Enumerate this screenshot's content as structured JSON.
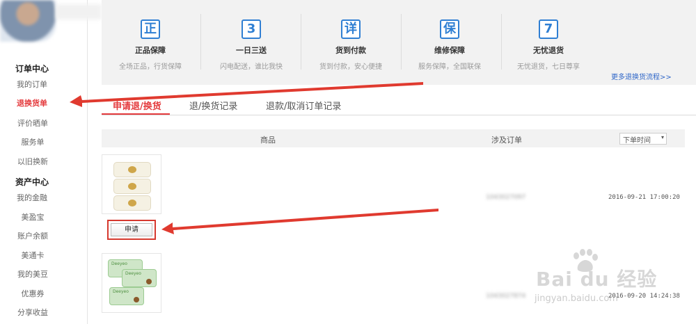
{
  "sidebar": {
    "section_orders": "订单中心",
    "orders": [
      {
        "label": "我的订单"
      },
      {
        "label": "退换货单",
        "active": true
      },
      {
        "label": "评价晒单"
      },
      {
        "label": "服务单"
      },
      {
        "label": "以旧换新"
      }
    ],
    "section_assets": "资产中心",
    "assets": [
      {
        "label": "我的金融"
      },
      {
        "label": "美盈宝"
      },
      {
        "label": "账户余额"
      },
      {
        "label": "美通卡"
      },
      {
        "label": "我的美豆"
      },
      {
        "label": "优惠券"
      },
      {
        "label": "分享收益"
      }
    ]
  },
  "services": [
    {
      "icon": "正",
      "icon_name": "authentic-icon",
      "title": "正品保障",
      "desc": "全场正品，行货保障"
    },
    {
      "icon": "3",
      "icon_name": "three-deliveries-icon",
      "title": "一日三送",
      "desc": "闪电配送，谁比我快"
    },
    {
      "icon": "详",
      "icon_name": "cod-icon",
      "title": "货到付款",
      "desc": "货到付款，安心便捷"
    },
    {
      "icon": "保",
      "icon_name": "warranty-icon",
      "title": "维修保障",
      "desc": "服务保障，全国联保"
    },
    {
      "icon": "7",
      "icon_name": "seven-day-return-icon",
      "title": "无忧退货",
      "desc": "无忧退货，七日尊享"
    }
  ],
  "more_link": "更多退换货流程>>",
  "tabs": [
    {
      "label": "申请退/换货",
      "active": true
    },
    {
      "label": "退/换货记录"
    },
    {
      "label": "退款/取消订单记录"
    }
  ],
  "table": {
    "col_goods": "商品",
    "col_order": "涉及订单",
    "sort_label": "下单时间",
    "sort_caret": "▾"
  },
  "rows": [
    {
      "order_id": "1043027097",
      "time": "2016-09-21 17:00:20",
      "apply_label": "申请"
    },
    {
      "order_id": "1043027874",
      "time": "2016-09-20 14:24:38"
    }
  ],
  "watermark": {
    "logo": "Bai du 经验",
    "url": "jingyan.baidu.com"
  },
  "colors": {
    "accent_red": "#e4393c",
    "icon_blue": "#2f7fd3",
    "link_blue": "#2f66c8"
  }
}
